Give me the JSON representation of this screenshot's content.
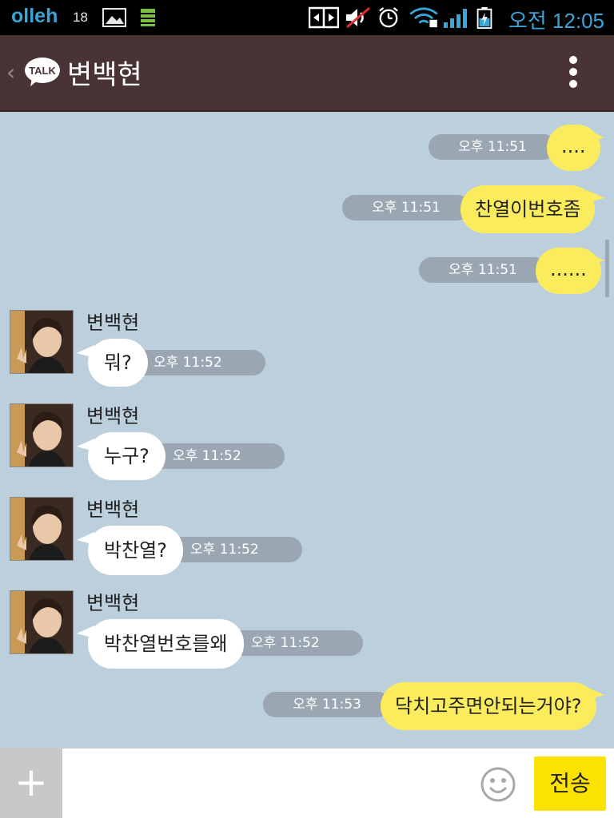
{
  "status_bar": {
    "carrier": "olleh",
    "notification_count": "18",
    "time": "오전 12:05",
    "icons": [
      "image-icon",
      "sim-icon",
      "nfc-icon",
      "mute-icon",
      "alarm-icon",
      "wifi-icon",
      "signal-icon",
      "battery-charging-icon"
    ],
    "accent_color": "#3aa6d8"
  },
  "header": {
    "back_icon": "chevron-left-icon",
    "logo_text": "TALK",
    "title": "변백현",
    "menu_icon": "more-vertical-icon",
    "background_color": "#4a3335"
  },
  "messages": [
    {
      "direction": "out",
      "time": "오후 11:51",
      "text": "...."
    },
    {
      "direction": "out",
      "time": "오후 11:51",
      "text": "찬열이번호좀"
    },
    {
      "direction": "out",
      "time": "오후 11:51",
      "text": "......"
    },
    {
      "direction": "in",
      "sender": "변백현",
      "time": "오후 11:52",
      "text": "뭐?"
    },
    {
      "direction": "in",
      "sender": "변백현",
      "time": "오후 11:52",
      "text": "누구?"
    },
    {
      "direction": "in",
      "sender": "변백현",
      "time": "오후 11:52",
      "text": "박찬열?"
    },
    {
      "direction": "in",
      "sender": "변백현",
      "time": "오후 11:52",
      "text": "박찬열번호를왜"
    },
    {
      "direction": "out",
      "time": "오후 11:53",
      "text": "닥치고주면안되는거야?"
    }
  ],
  "input_bar": {
    "plus_label": "+",
    "placeholder": "",
    "emoji_icon": "smiley-icon",
    "send_label": "전송",
    "send_color": "#fbe200"
  },
  "colors": {
    "chat_background": "#bccfdc",
    "outgoing_bubble": "#fbec5d",
    "incoming_bubble": "#ffffff",
    "time_pill": "#9aa7b2"
  }
}
